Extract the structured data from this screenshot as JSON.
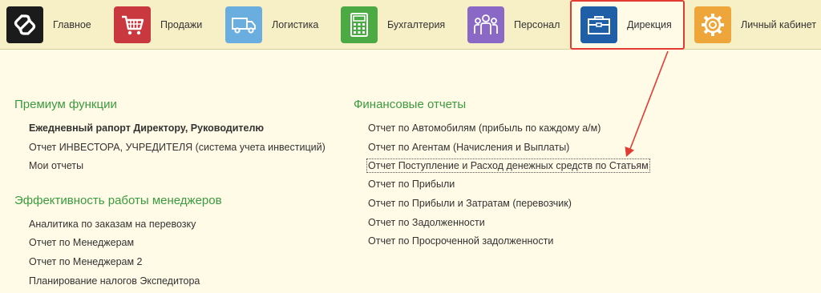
{
  "nav": {
    "items": [
      {
        "label": "Главное",
        "icon": "logo-icon",
        "color": "#1b1b1b"
      },
      {
        "label": "Продажи",
        "icon": "cart-icon",
        "color": "#c8383e"
      },
      {
        "label": "Логистика",
        "icon": "truck-icon",
        "color": "#6aaee0"
      },
      {
        "label": "Бухгалтерия",
        "icon": "calculator-icon",
        "color": "#4caa45"
      },
      {
        "label": "Персонал",
        "icon": "people-icon",
        "color": "#8a68c5"
      },
      {
        "label": "Дирекция",
        "icon": "briefcase-icon",
        "color": "#1e5fa8"
      },
      {
        "label": "Личный кабинет",
        "icon": "gear-icon",
        "color": "#eea53a"
      }
    ],
    "active": "Дирекция"
  },
  "sections": {
    "premium": {
      "title": "Премиум функции",
      "links": [
        "Ежедневный рапорт Директору, Руководителю",
        "Отчет ИНВЕСТОРА, УЧРЕДИТЕЛЯ (система учета инвестиций)",
        "Мои отчеты"
      ]
    },
    "managers": {
      "title": "Эффективность работы менеджеров",
      "links": [
        "Аналитика по заказам на перевозку",
        "Отчет по Менеджерам",
        "Отчет по Менеджерам 2",
        "Планирование налогов Экспедитора"
      ]
    },
    "finance": {
      "title": "Финансовые отчеты",
      "links": [
        "Отчет по Автомобилям (прибыль по каждому а/м)",
        "Отчет по Агентам (Начисления и Выплаты)",
        "Отчет Поступление и Расход денежных средств по Статьям",
        "Отчет по Прибыли",
        "Отчет по Прибыли и Затратам (перевозчик)",
        "Отчет по Задолженности",
        "Отчет по Просроченной задолженности"
      ]
    }
  },
  "colors": {
    "section_title": "#3a9a3f",
    "annotation": "#e23b34",
    "topbar": "#f7f0c6",
    "background": "#fffbe6"
  }
}
